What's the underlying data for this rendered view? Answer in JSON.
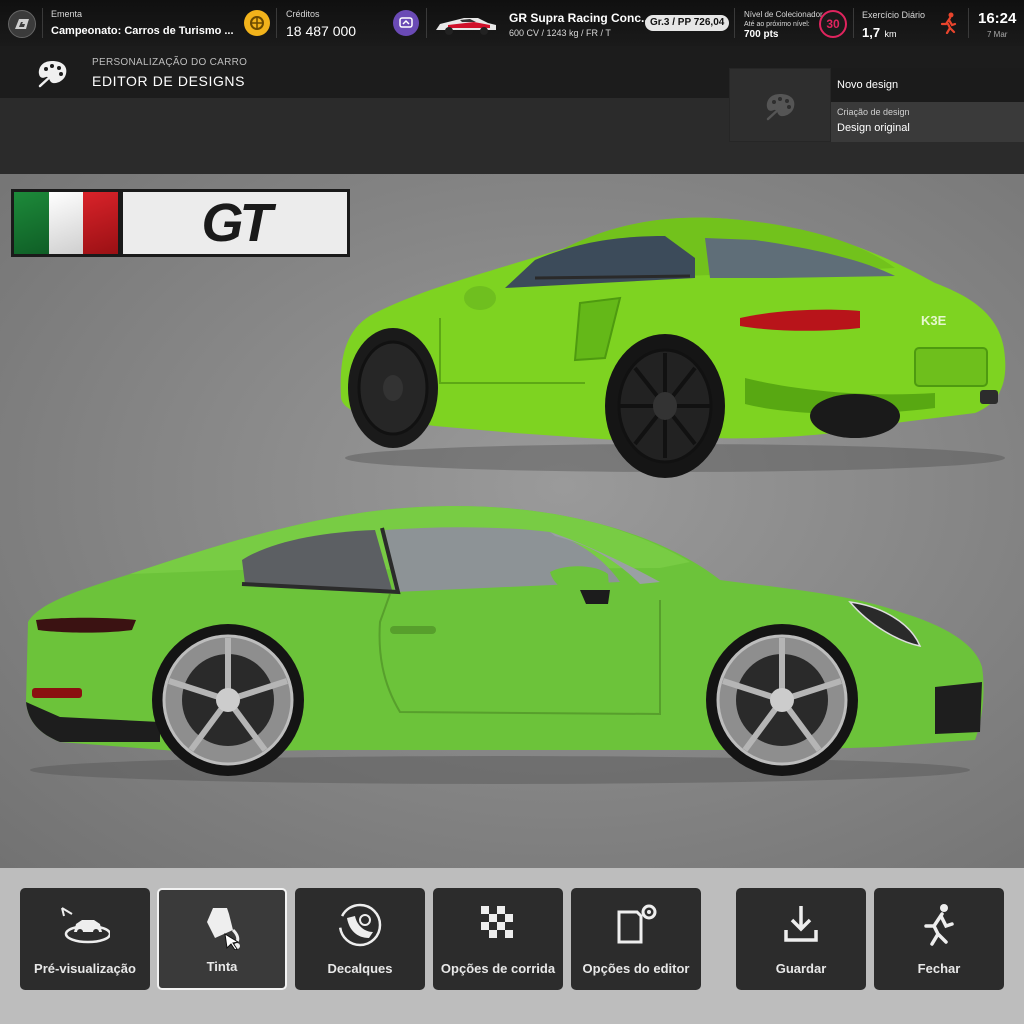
{
  "topbar": {
    "ementa_label": "Ementa",
    "ementa_value": "Campeonato: Carros de Turismo ...",
    "creditos_label": "Créditos",
    "creditos_value": "18 487 000",
    "car_name": "GR Supra Racing Conc...",
    "car_specs": "600 CV / 1243 kg / FR / T",
    "car_class": "Gr.3 / PP 726,04",
    "collector_label": "Nível de Colecionador",
    "collector_sub": "Até ao próximo nível:",
    "collector_pts": "700 pts",
    "collector_level": "30",
    "daily_label": "Exercício Diário",
    "daily_value": "1,7",
    "daily_unit": "km",
    "time": "16:24",
    "date": "7 Mar"
  },
  "header": {
    "section": "PERSONALIZAÇÃO DO CARRO",
    "title": "EDITOR DE DESIGNS"
  },
  "design_panel": {
    "new_design": "Novo design",
    "creation_label": "Criação de design",
    "creation_value": "Design original"
  },
  "banner": {
    "logo_text": "GT",
    "flag": "italian-flag"
  },
  "cars": {
    "rear_badge": "K3E",
    "body_color": "#7ed321",
    "body_color_2": "#6cc33a"
  },
  "toolbar": {
    "items": [
      {
        "label": "Pré-visualização",
        "icon": "car-preview-icon"
      },
      {
        "label": "Tinta",
        "icon": "paint-bucket-icon"
      },
      {
        "label": "Decalques",
        "icon": "decal-icon"
      },
      {
        "label": "Opções de corrida",
        "icon": "checkered-flag-icon"
      },
      {
        "label": "Opções do editor",
        "icon": "editor-options-icon"
      },
      {
        "label": "Guardar",
        "icon": "download-icon"
      },
      {
        "label": "Fechar",
        "icon": "exit-icon"
      }
    ]
  },
  "colors": {
    "accent_yellow": "#f2b31b",
    "level_red": "#e0245e",
    "runner_red": "#e8442c"
  }
}
